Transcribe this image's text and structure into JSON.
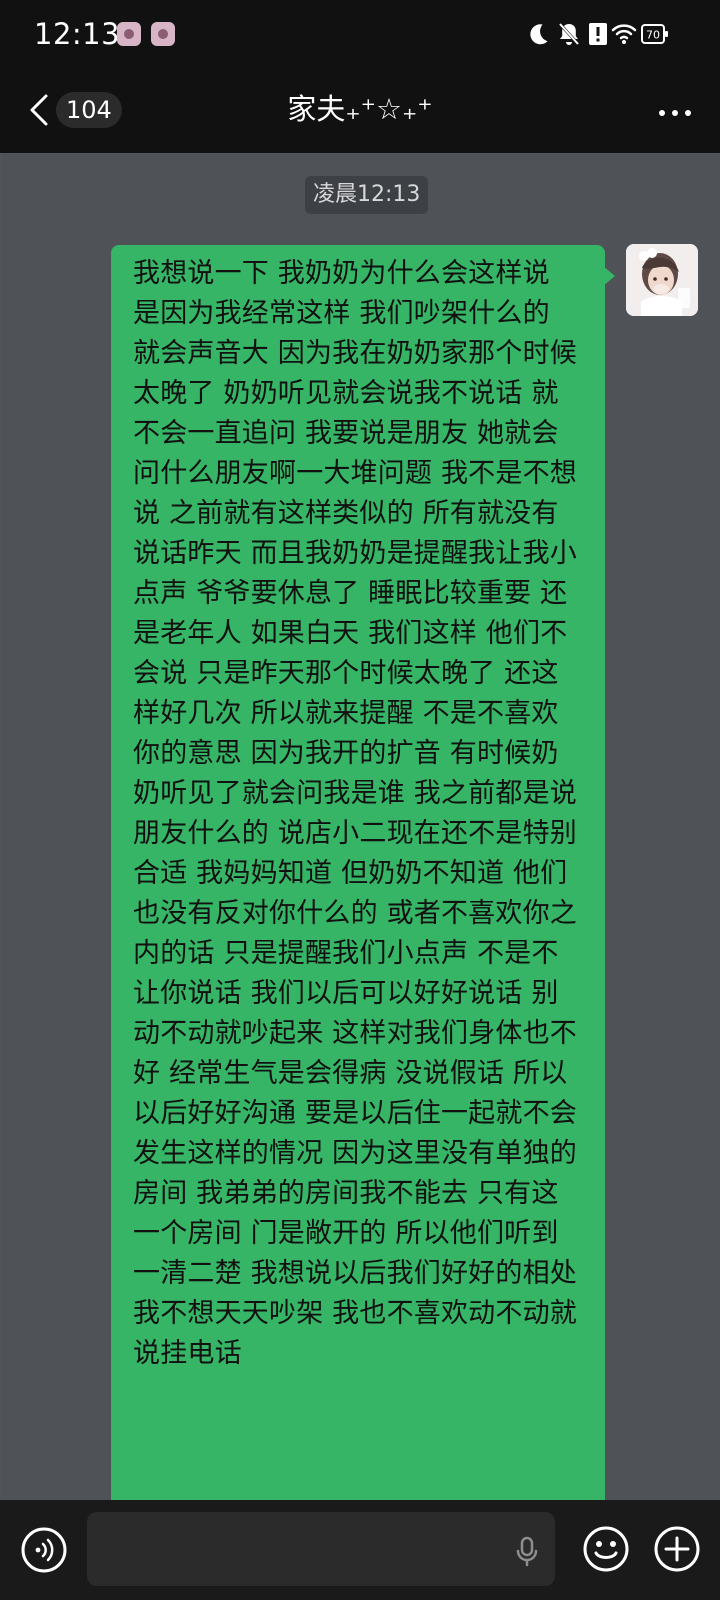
{
  "status_bar": {
    "time": "12:13",
    "battery": "70",
    "icons": [
      "notification-app-icon",
      "notification-app-icon",
      "moon-icon",
      "mute-bell-icon",
      "alert-icon",
      "wifi-icon",
      "battery-icon"
    ]
  },
  "header": {
    "unread_count": "104",
    "title": "家夫₊⁺☆₊⁺",
    "more_icon": "more-dots-icon"
  },
  "chat": {
    "timestamp": "凌晨12:13",
    "message": "我想说一下 我奶奶为什么会这样说 是因为我经常这样 我们吵架什么的 就会声音大 因为我在奶奶家那个时候太晚了 奶奶听见就会说我不说话 就不会一直追问 我要说是朋友 她就会问什么朋友啊一大堆问题 我不是不想说 之前就有这样类似的 所有就没有说话昨天 而且我奶奶是提醒我让我小点声 爷爷要休息了 睡眠比较重要 还是老年人 如果白天 我们这样 他们不会说 只是昨天那个时候太晚了 还这样好几次 所以就来提醒 不是不喜欢你的意思 因为我开的扩音 有时候奶奶听见了就会问我是谁 我之前都是说朋友什么的 说店小二现在还不是特别合适 我妈妈知道 但奶奶不知道 他们也没有反对你什么的 或者不喜欢你之内的话 只是提醒我们小点声 不是不让你说话 我们以后可以好好说话 别动不动就吵起来 这样对我们身体也不好 经常生气是会得病 没说假话 所以以后好好沟通 要是以后住一起就不会发生这样的情况 因为这里没有单独的房间 我弟弟的房间我不能去 只有这一个房间 门是敞开的 所以他们听到一清二楚 我想说以后我们好好的相处 我不想天天吵架 我也不喜欢动不动就说挂电话",
    "bubble_color": "#35b565"
  },
  "input_bar": {
    "placeholder": "",
    "voice_icon": "voice-wave-icon",
    "mic_icon": "microphone-icon",
    "emoji_icon": "smiley-icon",
    "add_icon": "plus-circle-icon"
  }
}
